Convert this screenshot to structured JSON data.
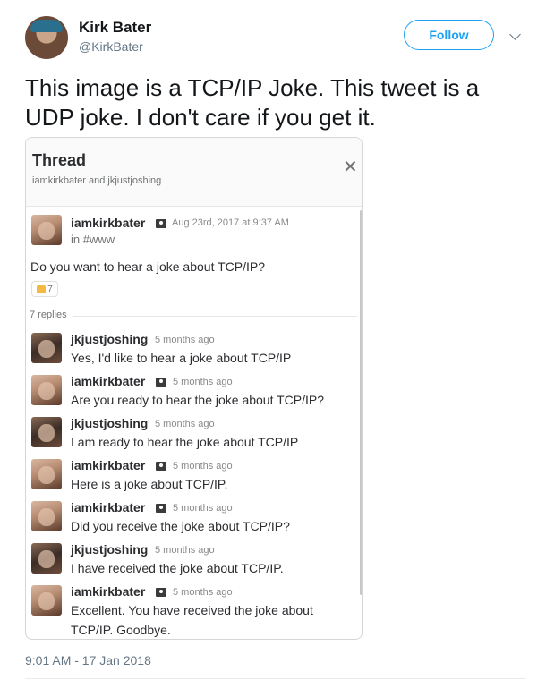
{
  "tweet": {
    "author_name": "Kirk Bater",
    "handle": "@KirkBater",
    "follow_label": "Follow",
    "text": "This image is a TCP/IP Joke.  This tweet is a UDP joke.  I don't care if you get it.",
    "timestamp": "9:01 AM - 17 Jan 2018"
  },
  "thread": {
    "title": "Thread",
    "participants": "iamkirkbater and jkjustjoshing",
    "parent": {
      "user": "iamkirkbater",
      "time": "Aug 23rd, 2017 at 9:37 AM",
      "channel": "in #www",
      "text": "Do you want to hear a joke about TCP/IP?",
      "reaction_count": "7"
    },
    "replies_label": "7 replies",
    "replies": [
      {
        "user": "jkjustjoshing",
        "time": "5 months ago",
        "text": "Yes, I'd like to hear a joke about TCP/IP"
      },
      {
        "user": "iamkirkbater",
        "time": "5 months ago",
        "text": "Are you ready to hear the joke about TCP/IP?"
      },
      {
        "user": "jkjustjoshing",
        "time": "5 months ago",
        "text": "I am ready to hear the joke about TCP/IP"
      },
      {
        "user": "iamkirkbater",
        "time": "5 months ago",
        "text": "Here is a joke about TCP/IP."
      },
      {
        "user": "iamkirkbater",
        "time": "5 months ago",
        "text": "Did you receive the joke about TCP/IP?"
      },
      {
        "user": "jkjustjoshing",
        "time": "5 months ago",
        "text": "I have received the joke about TCP/IP."
      },
      {
        "user": "iamkirkbater",
        "time": "5 months ago",
        "text": "Excellent.  You have received the joke about TCP/IP.  Goodbye."
      }
    ]
  },
  "colors": {
    "accent": "#1da1f2",
    "muted": "#657786"
  },
  "icons": {
    "close": "close-icon",
    "chevron": "chevron-down-icon",
    "badge": "pirate-flag-icon",
    "reaction": "thumbs-up-icon"
  }
}
